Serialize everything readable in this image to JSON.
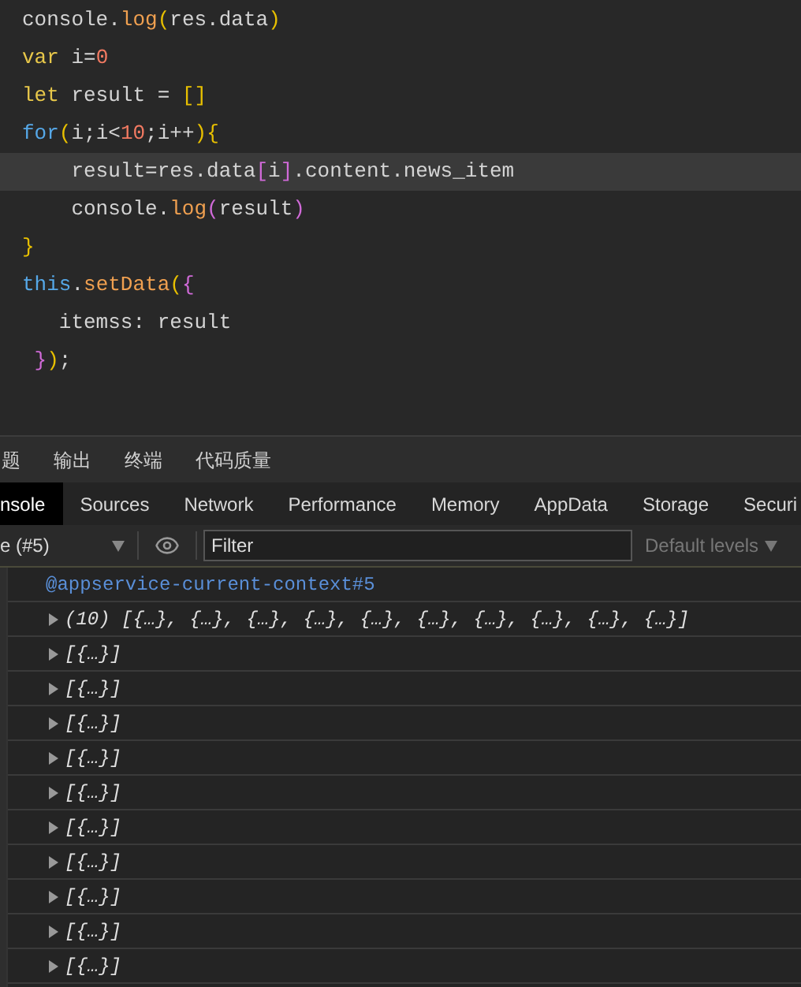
{
  "editor": {
    "lines": [
      {
        "highlighted": false,
        "tokens": [
          {
            "kind": "plain",
            "text": "console."
          },
          {
            "kind": "method",
            "text": "log"
          },
          {
            "kind": "paren",
            "text": "("
          },
          {
            "kind": "plain",
            "text": "res.data"
          },
          {
            "kind": "paren",
            "text": ")"
          }
        ]
      },
      {
        "highlighted": false,
        "tokens": [
          {
            "kind": "decl",
            "text": "var"
          },
          {
            "kind": "plain",
            "text": " i="
          },
          {
            "kind": "number",
            "text": "0"
          }
        ]
      },
      {
        "highlighted": false,
        "tokens": [
          {
            "kind": "decl",
            "text": "let"
          },
          {
            "kind": "plain",
            "text": " result = "
          },
          {
            "kind": "paren",
            "text": "[]"
          }
        ]
      },
      {
        "highlighted": false,
        "tokens": [
          {
            "kind": "keyword",
            "text": "for"
          },
          {
            "kind": "paren",
            "text": "("
          },
          {
            "kind": "plain",
            "text": "i;i<"
          },
          {
            "kind": "number",
            "text": "10"
          },
          {
            "kind": "plain",
            "text": ";i++"
          },
          {
            "kind": "paren",
            "text": ")"
          },
          {
            "kind": "paren",
            "text": "{"
          }
        ]
      },
      {
        "highlighted": true,
        "tokens": [
          {
            "kind": "plain",
            "text": "    result=res.data"
          },
          {
            "kind": "bracket",
            "text": "["
          },
          {
            "kind": "plain",
            "text": "i"
          },
          {
            "kind": "bracket",
            "text": "]"
          },
          {
            "kind": "plain",
            "text": ".content.news_item"
          }
        ]
      },
      {
        "highlighted": false,
        "tokens": [
          {
            "kind": "plain",
            "text": "    console."
          },
          {
            "kind": "method",
            "text": "log"
          },
          {
            "kind": "bracket",
            "text": "("
          },
          {
            "kind": "plain",
            "text": "result"
          },
          {
            "kind": "bracket",
            "text": ")"
          }
        ]
      },
      {
        "highlighted": false,
        "tokens": [
          {
            "kind": "paren",
            "text": "}"
          }
        ]
      },
      {
        "highlighted": false,
        "tokens": [
          {
            "kind": "keyword",
            "text": "this"
          },
          {
            "kind": "plain",
            "text": "."
          },
          {
            "kind": "method",
            "text": "setData"
          },
          {
            "kind": "paren",
            "text": "("
          },
          {
            "kind": "bracket",
            "text": "{"
          }
        ]
      },
      {
        "highlighted": false,
        "tokens": [
          {
            "kind": "plain",
            "text": "   itemss: result"
          }
        ]
      },
      {
        "highlighted": false,
        "tokens": [
          {
            "kind": "bracket",
            "text": " }"
          },
          {
            "kind": "paren",
            "text": ")"
          },
          {
            "kind": "plain",
            "text": ";"
          }
        ]
      }
    ]
  },
  "panel_tabs": [
    "题",
    "输出",
    "终端",
    "代码质量"
  ],
  "devtools_tabs": [
    {
      "label": "nsole",
      "selected": true
    },
    {
      "label": "Sources",
      "selected": false
    },
    {
      "label": "Network",
      "selected": false
    },
    {
      "label": "Performance",
      "selected": false
    },
    {
      "label": "Memory",
      "selected": false
    },
    {
      "label": "AppData",
      "selected": false
    },
    {
      "label": "Storage",
      "selected": false
    },
    {
      "label": "Securi",
      "selected": false
    }
  ],
  "toolbar": {
    "context": "e (#5)",
    "filter": {
      "placeholder": "Filter"
    },
    "levels": "Default levels"
  },
  "console": {
    "context_link": "@appservice-current-context#5",
    "entries": [
      "(10) [{…}, {…}, {…}, {…}, {…}, {…}, {…}, {…}, {…}, {…}]",
      "[{…}]",
      "[{…}]",
      "[{…}]",
      "[{…}]",
      "[{…}]",
      "[{…}]",
      "[{…}]",
      "[{…}]",
      "[{…}]",
      "[{…}]"
    ]
  }
}
